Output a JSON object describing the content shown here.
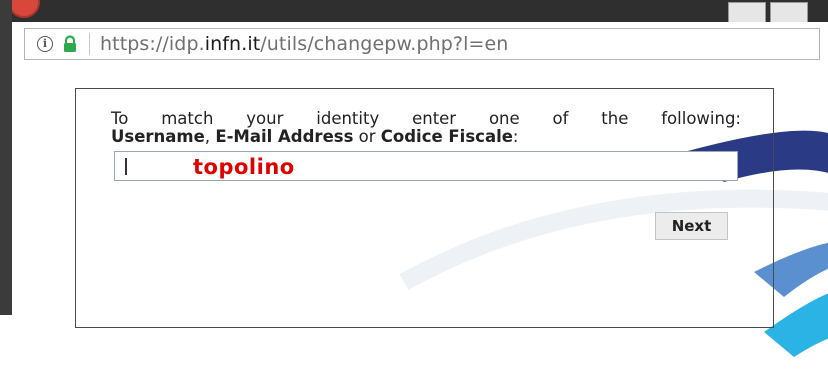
{
  "browser": {
    "url_prefix": "https://idp.",
    "url_host": "infn.it",
    "url_suffix": "/utils/changepw.php?l=en"
  },
  "form": {
    "prompt_line1": "To match your identity enter one of the following:",
    "prompt_username": "Username",
    "prompt_comma": ", ",
    "prompt_email": "E-Mail Address",
    "prompt_or": " or ",
    "prompt_codice": "Codice Fiscale",
    "prompt_colon": ":",
    "input_value": "topolino",
    "next_label": "Next"
  },
  "colors": {
    "input_value": "#e00000",
    "swoosh_dark": "#2b3a85",
    "swoosh_light": "#2bb3e6"
  }
}
